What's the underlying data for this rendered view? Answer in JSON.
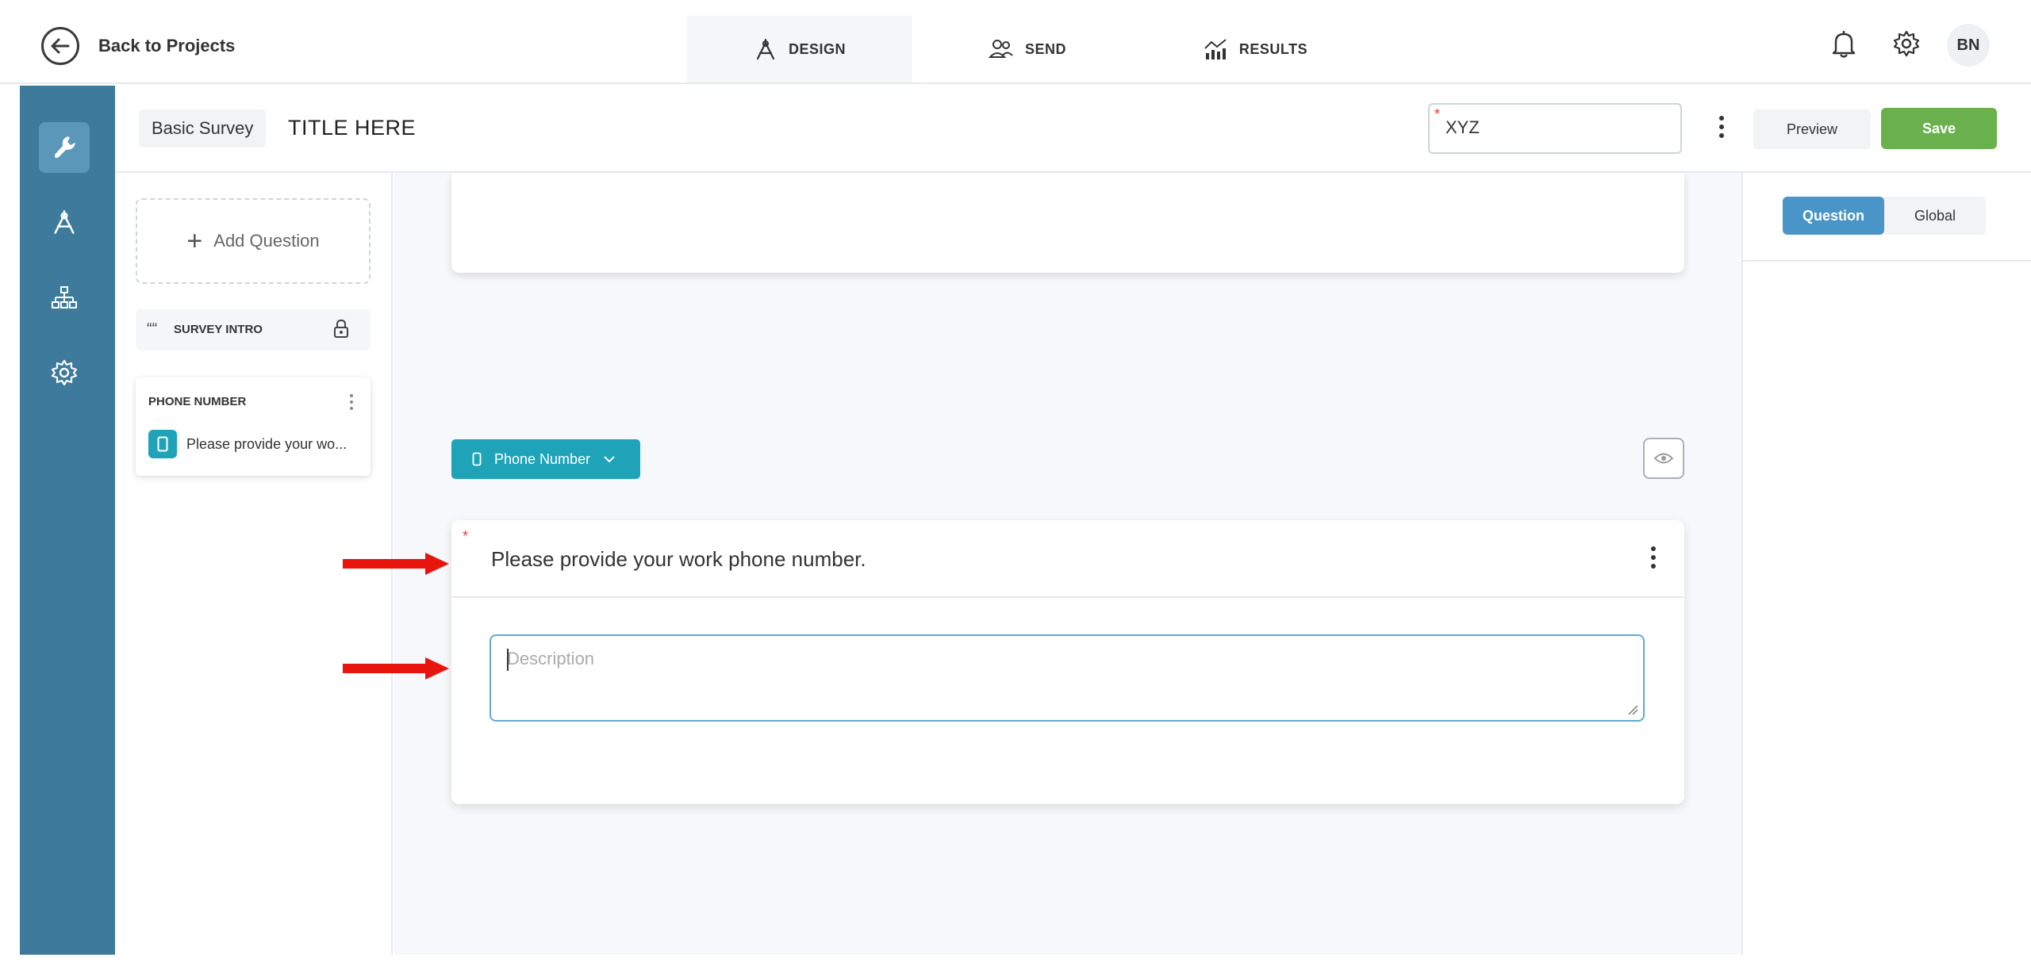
{
  "topbar": {
    "back_label": "Back to Projects",
    "tabs": [
      {
        "label": "DESIGN",
        "icon": "compass-icon",
        "active": true
      },
      {
        "label": "SEND",
        "icon": "users-icon",
        "active": false
      },
      {
        "label": "RESULTS",
        "icon": "chart-icon",
        "active": false
      }
    ],
    "avatar_initials": "BN"
  },
  "rail": {
    "items": [
      "wrench-icon",
      "compass-icon",
      "sitemap-icon",
      "gear-icon"
    ],
    "active_index": 0
  },
  "subheader": {
    "survey_type": "Basic Survey",
    "survey_title": "TITLE HERE",
    "name_value": "XYZ",
    "preview_label": "Preview",
    "save_label": "Save"
  },
  "question_list": {
    "add_label": "Add Question",
    "intro_label": "SURVEY INTRO",
    "items": [
      {
        "type_label": "PHONE NUMBER",
        "text": "Please provide your wo..."
      }
    ]
  },
  "editor": {
    "type_pill_label": "Phone Number",
    "question_text": "Please provide your work phone number.",
    "description_placeholder": "Description"
  },
  "settings_panel": {
    "tabs": [
      "Question",
      "Global"
    ],
    "active_tab": "Question"
  },
  "colors": {
    "rail": "#3d7a9c",
    "accent_teal": "#1fa3b8",
    "save_green": "#6ab04c",
    "segment_blue": "#4a95c7",
    "annotation_red": "#e8150f"
  }
}
